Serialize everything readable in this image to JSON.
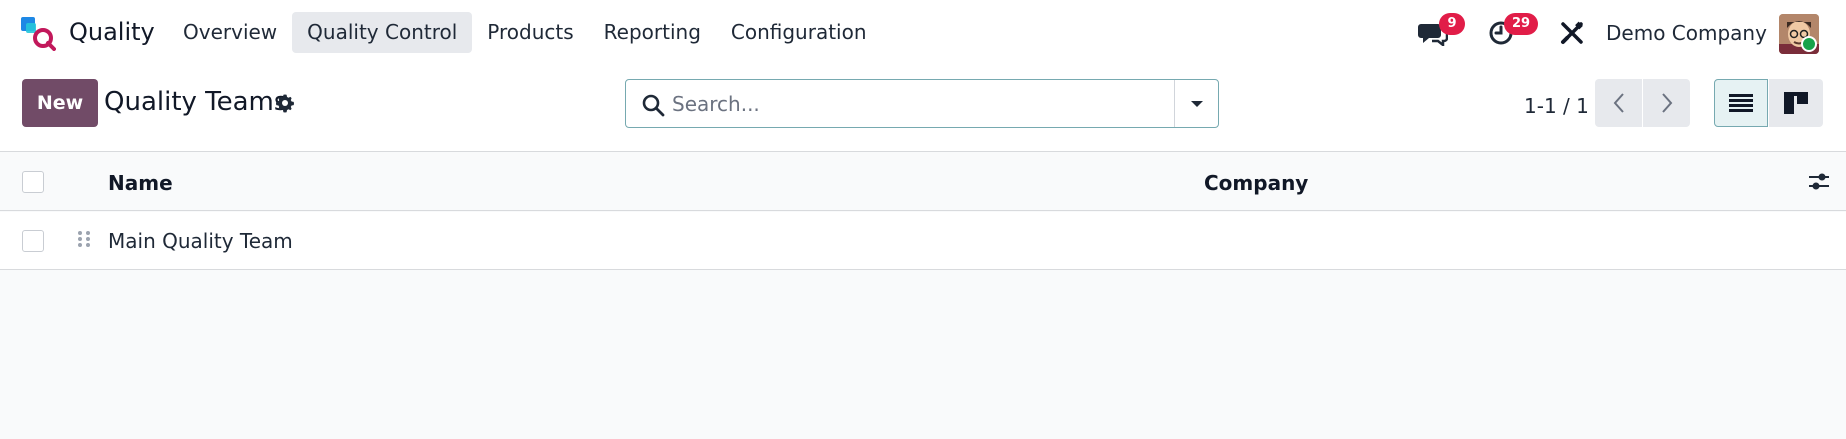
{
  "app": {
    "name": "Quality"
  },
  "menu": {
    "items": [
      {
        "label": "Overview"
      },
      {
        "label": "Quality Control",
        "active": true
      },
      {
        "label": "Products"
      },
      {
        "label": "Reporting"
      },
      {
        "label": "Configuration"
      }
    ]
  },
  "systray": {
    "messages_count": "9",
    "activities_count": "29",
    "company": "Demo Company"
  },
  "control_panel": {
    "new_label": "New",
    "title": "Quality Teams",
    "search_placeholder": "Search...",
    "pager": "1-1 / 1"
  },
  "list": {
    "columns": [
      "Name",
      "Company"
    ],
    "rows": [
      {
        "name": "Main Quality Team",
        "company": ""
      }
    ]
  },
  "colors": {
    "primary": "#714b67",
    "badge": "#e11d48",
    "active_menu_bg": "#e7e9ed",
    "search_border": "#76a9b0"
  }
}
